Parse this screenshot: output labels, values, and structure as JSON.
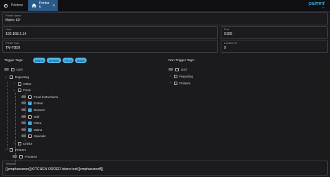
{
  "tabs": [
    {
      "label": "Printers",
      "icon": "gear-icon"
    },
    {
      "label": "Printer 5",
      "icon": "printer-icon"
    }
  ],
  "logo": {
    "brand": "paimnt",
    "sub": "kp"
  },
  "form": {
    "printer_name": {
      "label": "Printer Name",
      "value": "Bistro KP"
    },
    "host": {
      "label": "Host",
      "value": "192.168.1.14"
    },
    "port": {
      "label": "Port",
      "value": "9100"
    },
    "printer_type": {
      "label": "Printer Type",
      "value": "TM-T82II"
    },
    "location_id": {
      "label": "Location ID",
      "value": "9"
    }
  },
  "trigger_tags": {
    "title": "Trigger Tags:",
    "chips": [
      "Entree",
      "Dessert",
      "Pizza",
      "Mains"
    ]
  },
  "tree": {
    "gst": "GST",
    "reporting": "Reporting",
    "other": "Other",
    "food": "Food",
    "food_instructions": "Food Instructions",
    "entree": "Entree",
    "dessert": "Dessert",
    "grill": "Grill",
    "pizza": "Pizza",
    "mains": "Mains",
    "specials": "Specials",
    "drinks": "Drinks",
    "printers": "Printers",
    "p_entree": "P Entree"
  },
  "non_trigger": {
    "title": "Non-Trigger Tags:",
    "items": [
      "GST",
      "Reporting",
      "Printers"
    ]
  },
  "template": {
    "label": "Template",
    "value": "{{emphasizeon}}KITCHEN ORDER bistro test{{emphasizeoff}}"
  }
}
